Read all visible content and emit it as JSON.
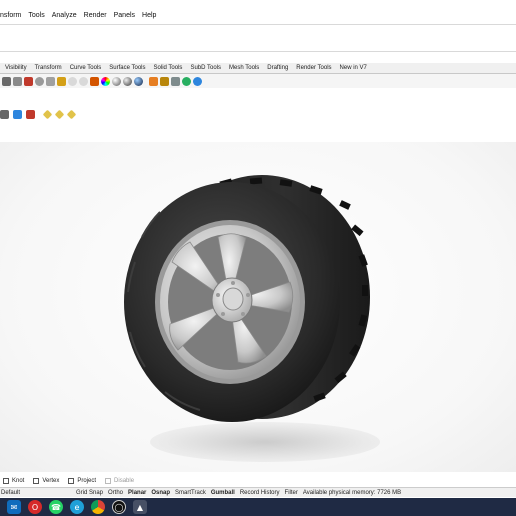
{
  "menu": {
    "items": [
      "nsform",
      "Tools",
      "Analyze",
      "Render",
      "Panels",
      "Help"
    ]
  },
  "tabs": [
    "Visibility",
    "Transform",
    "Curve Tools",
    "Surface Tools",
    "Solid Tools",
    "SubD Tools",
    "Mesh Tools",
    "Drafting",
    "Render Tools",
    "New in V7"
  ],
  "toolbar_icons": [
    "rotate-view-icon",
    "grid-icon",
    "car-icon",
    "circle-icon",
    "curve-icon",
    "curve-network-icon",
    "lightbulb-icon",
    "lightbulb-icon",
    "material-ball-icon",
    "color-wheel-icon",
    "sphere-icon",
    "render-sphere-icon",
    "blue-sphere-icon",
    "brush-icon",
    "settings-icon",
    "selection-icon",
    "globe-icon",
    "help-icon"
  ],
  "secondary_toolbar_icons": [
    "grid-select-icon",
    "copy-icon",
    "x-icon",
    "diamond-icon",
    "diamond-icon",
    "diamond-icon"
  ],
  "osnap": {
    "options": [
      {
        "label": "Knot",
        "enabled": true
      },
      {
        "label": "Vertex",
        "enabled": true
      },
      {
        "label": "Project",
        "enabled": true
      },
      {
        "label": "Disable",
        "enabled": false
      }
    ]
  },
  "status": {
    "layer": "Default",
    "items": [
      {
        "label": "Grid Snap",
        "bold": false
      },
      {
        "label": "Ortho",
        "bold": false
      },
      {
        "label": "Planar",
        "bold": true
      },
      {
        "label": "Osnap",
        "bold": true
      },
      {
        "label": "SmartTrack",
        "bold": false
      },
      {
        "label": "Gumball",
        "bold": true
      },
      {
        "label": "Record History",
        "bold": false
      },
      {
        "label": "Filter",
        "bold": false
      }
    ],
    "memory": "Available physical memory: 7726 MB"
  },
  "taskbar": {
    "apps": [
      "outlook-icon",
      "opera-icon",
      "whatsapp-icon",
      "edge-icon",
      "chrome-icon",
      "obs-icon",
      "rhino-icon"
    ]
  },
  "colors": {
    "taskbar": "#1f2a44",
    "tire": "#2b2b2b",
    "rim": "#c9c9c9"
  }
}
